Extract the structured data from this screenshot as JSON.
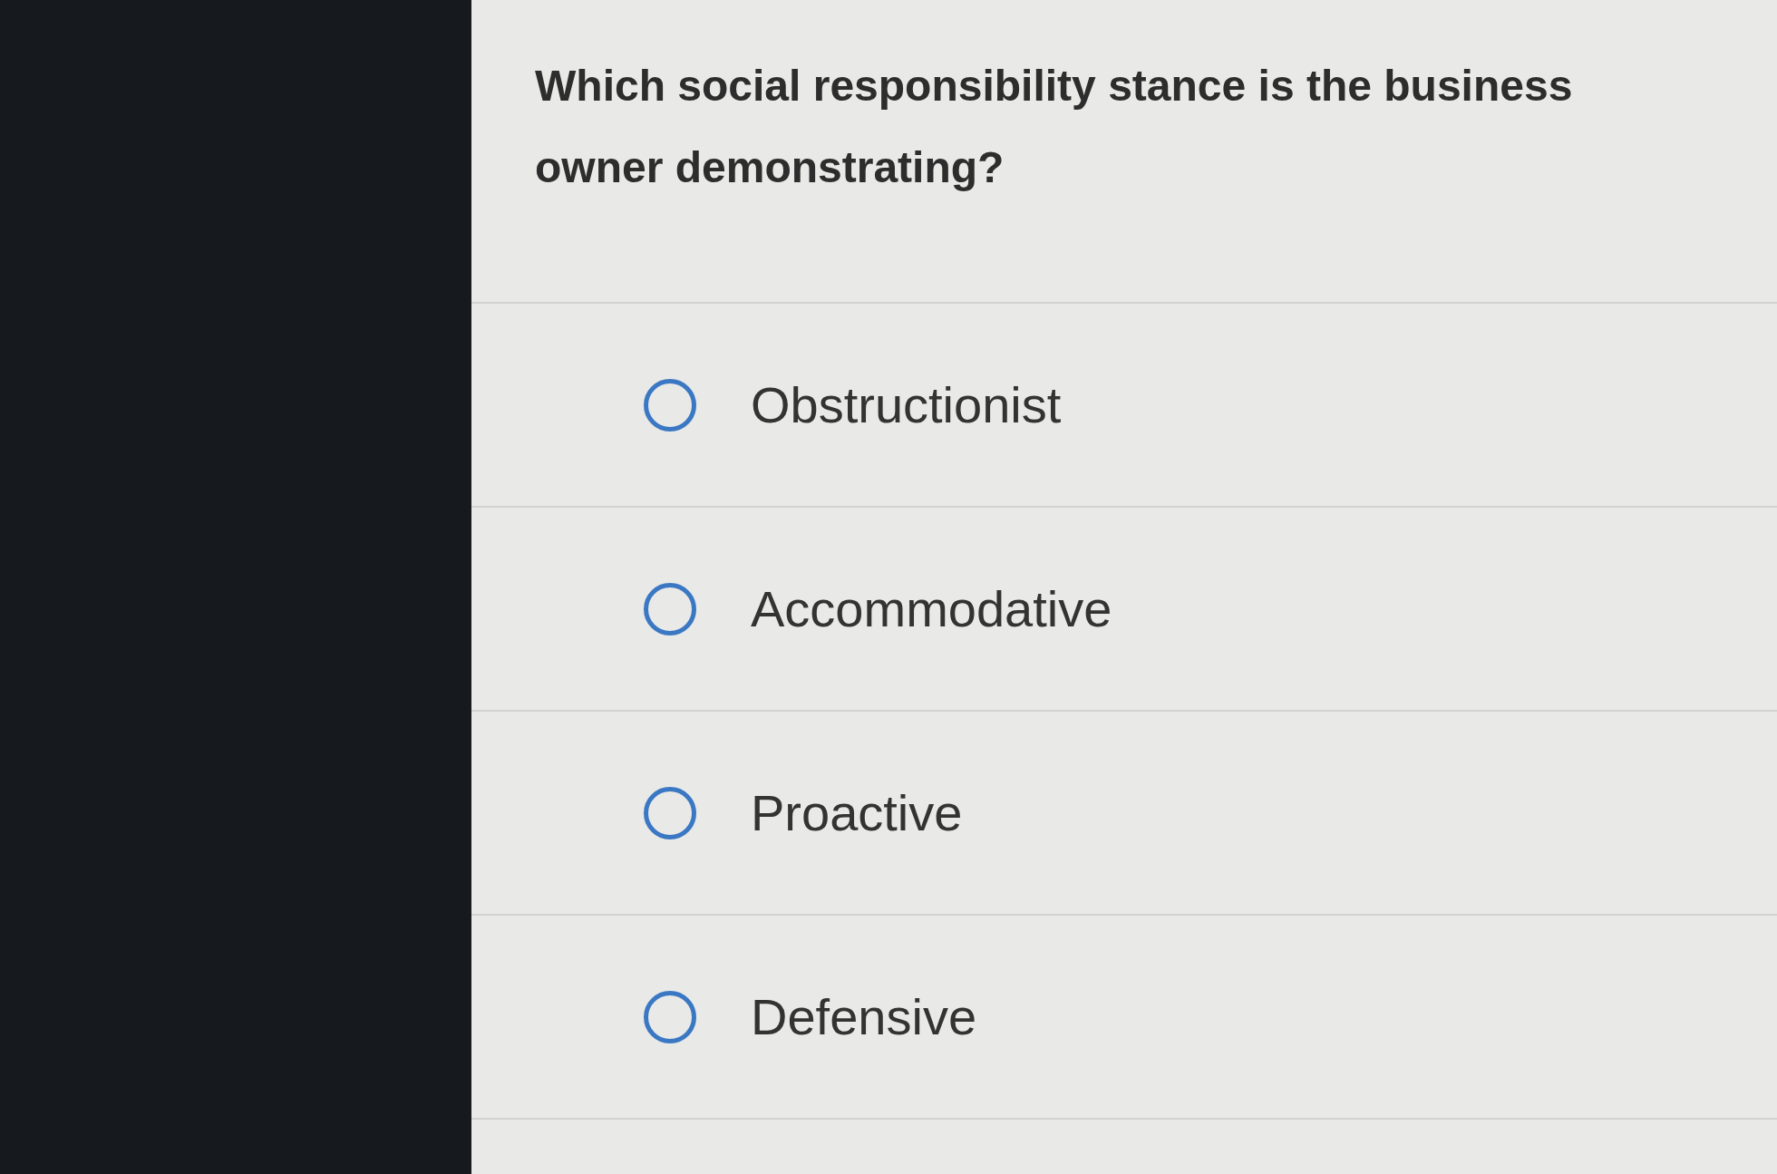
{
  "question": "Which social responsibility stance is the business owner demonstrating?",
  "options": [
    {
      "label": "Obstructionist",
      "selected": false
    },
    {
      "label": "Accommodative",
      "selected": false
    },
    {
      "label": "Proactive",
      "selected": false
    },
    {
      "label": "Defensive",
      "selected": false
    }
  ]
}
